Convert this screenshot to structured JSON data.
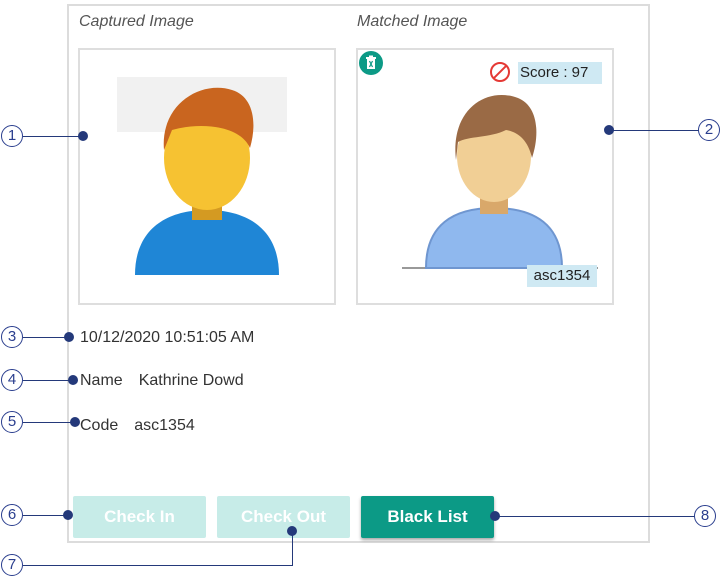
{
  "panel": {
    "captured_heading": "Captured Image",
    "matched_heading": "Matched Image"
  },
  "match": {
    "score_label": "Score : 97",
    "matched_code_tag": "asc1354",
    "delete_icon": "trash-icon",
    "blocked_icon": "no-entry-icon"
  },
  "record": {
    "timestamp": "10/12/2020 10:51:05 AM",
    "name_label": "Name",
    "name_value": "Kathrine Dowd",
    "code_label": "Code",
    "code_value": "asc1354"
  },
  "actions": {
    "check_in": "Check In",
    "check_out": "Check Out",
    "black_list": "Black List"
  },
  "callouts": [
    "1",
    "2",
    "3",
    "4",
    "5",
    "6",
    "7",
    "8"
  ],
  "colors": {
    "accent": "#0c9a86",
    "accent_disabled": "#c7ece8",
    "callout": "#2a3e8e",
    "highlight": "#cfe9f3",
    "blocked": "#e53935"
  }
}
